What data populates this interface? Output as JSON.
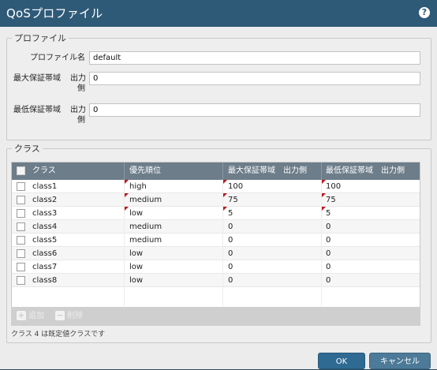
{
  "dialog": {
    "title": "QoSプロファイル",
    "help_icon": "?"
  },
  "profile_section": {
    "legend": "プロファイル",
    "name_label": "プロファイル名",
    "name_value": "default",
    "max_label_1": "最大保証帯域",
    "max_label_2": "出力",
    "max_label_3": "側",
    "max_value": "0",
    "min_label_1": "最低保証帯域",
    "min_label_2": "出力",
    "min_label_3": "側",
    "min_value": "0"
  },
  "class_section": {
    "legend": "クラス",
    "columns": [
      "クラス",
      "優先順位",
      "最大保証帯域　出力側",
      "最低保証帯域　出力側"
    ],
    "rows": [
      {
        "class": "class1",
        "priority": "high",
        "max": "100",
        "min": "100",
        "modified": true
      },
      {
        "class": "class2",
        "priority": "medium",
        "max": "75",
        "min": "75",
        "modified": true
      },
      {
        "class": "class3",
        "priority": "low",
        "max": "5",
        "min": "5",
        "modified": true
      },
      {
        "class": "class4",
        "priority": "medium",
        "max": "0",
        "min": "0",
        "modified": false
      },
      {
        "class": "class5",
        "priority": "medium",
        "max": "0",
        "min": "0",
        "modified": false
      },
      {
        "class": "class6",
        "priority": "low",
        "max": "0",
        "min": "0",
        "modified": false
      },
      {
        "class": "class7",
        "priority": "low",
        "max": "0",
        "min": "0",
        "modified": false
      },
      {
        "class": "class8",
        "priority": "low",
        "max": "0",
        "min": "0",
        "modified": false
      }
    ],
    "add_label": "追加",
    "delete_label": "削除",
    "note": "クラス 4 は既定値クラスです"
  },
  "buttons": {
    "ok": "OK",
    "cancel": "キャンセル"
  },
  "colors": {
    "titlebar": "#2e5a78",
    "grid_header": "#6d7d89",
    "ok_button": "#2f6a92",
    "modified_flag": "#c0141b"
  }
}
